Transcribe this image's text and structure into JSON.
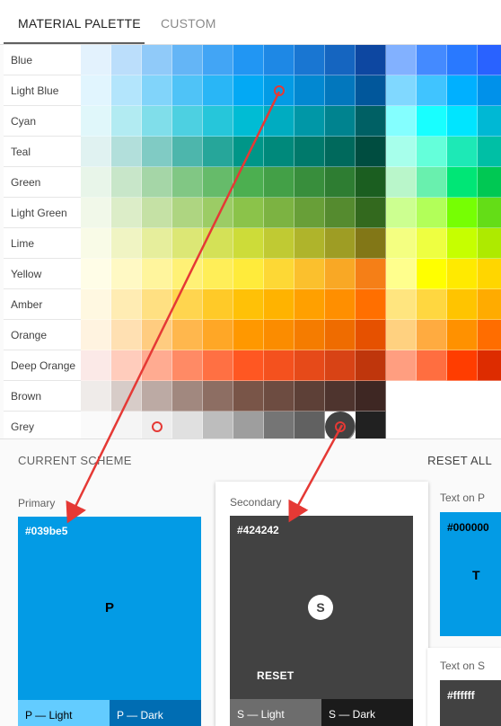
{
  "tabs": {
    "palette": "MATERIAL PALETTE",
    "custom": "CUSTOM"
  },
  "palette": {
    "rows": [
      {
        "name": "Blue",
        "colors": [
          "#e3f2fd",
          "#bbdefb",
          "#90caf9",
          "#64b5f6",
          "#42a5f5",
          "#2196f3",
          "#1e88e5",
          "#1976d2",
          "#1565c0",
          "#0d47a1",
          "#82b1ff",
          "#448aff",
          "#2979ff",
          "#2962ff"
        ]
      },
      {
        "name": "Light Blue",
        "colors": [
          "#e1f5fe",
          "#b3e5fc",
          "#81d4fa",
          "#4fc3f7",
          "#29b6f6",
          "#03a9f4",
          "#039be5",
          "#0288d1",
          "#0277bd",
          "#01579b",
          "#80d8ff",
          "#40c4ff",
          "#00b0ff",
          "#0091ea"
        ]
      },
      {
        "name": "Cyan",
        "colors": [
          "#e0f7fa",
          "#b2ebf2",
          "#80deea",
          "#4dd0e1",
          "#26c6da",
          "#00bcd4",
          "#00acc1",
          "#0097a7",
          "#00838f",
          "#006064",
          "#84ffff",
          "#18ffff",
          "#00e5ff",
          "#00b8d4"
        ]
      },
      {
        "name": "Teal",
        "colors": [
          "#e0f2f1",
          "#b2dfdb",
          "#80cbc4",
          "#4db6ac",
          "#26a69a",
          "#009688",
          "#00897b",
          "#00796b",
          "#00695c",
          "#004d40",
          "#a7ffeb",
          "#64ffda",
          "#1de9b6",
          "#00bfa5"
        ]
      },
      {
        "name": "Green",
        "colors": [
          "#e8f5e9",
          "#c8e6c9",
          "#a5d6a7",
          "#81c784",
          "#66bb6a",
          "#4caf50",
          "#43a047",
          "#388e3c",
          "#2e7d32",
          "#1b5e20",
          "#b9f6ca",
          "#69f0ae",
          "#00e676",
          "#00c853"
        ]
      },
      {
        "name": "Light Green",
        "colors": [
          "#f1f8e9",
          "#dcedc8",
          "#c5e1a5",
          "#aed581",
          "#9ccc65",
          "#8bc34a",
          "#7cb342",
          "#689f38",
          "#558b2f",
          "#33691e",
          "#ccff90",
          "#b2ff59",
          "#76ff03",
          "#64dd17"
        ]
      },
      {
        "name": "Lime",
        "colors": [
          "#f9fbe7",
          "#f0f4c3",
          "#e6ee9c",
          "#dce775",
          "#d4e157",
          "#cddc39",
          "#c0ca33",
          "#afb42b",
          "#9e9d24",
          "#827717",
          "#f4ff81",
          "#eeff41",
          "#c6ff00",
          "#aeea00"
        ]
      },
      {
        "name": "Yellow",
        "colors": [
          "#fffde7",
          "#fff9c4",
          "#fff59d",
          "#fff176",
          "#ffee58",
          "#ffeb3b",
          "#fdd835",
          "#fbc02d",
          "#f9a825",
          "#f57f17",
          "#ffff8d",
          "#ffff00",
          "#ffea00",
          "#ffd600"
        ]
      },
      {
        "name": "Amber",
        "colors": [
          "#fff8e1",
          "#ffecb3",
          "#ffe082",
          "#ffd54f",
          "#ffca28",
          "#ffc107",
          "#ffb300",
          "#ffa000",
          "#ff8f00",
          "#ff6f00",
          "#ffe57f",
          "#ffd740",
          "#ffc400",
          "#ffab00"
        ]
      },
      {
        "name": "Orange",
        "colors": [
          "#fff3e0",
          "#ffe0b2",
          "#ffcc80",
          "#ffb74d",
          "#ffa726",
          "#ff9800",
          "#fb8c00",
          "#f57c00",
          "#ef6c00",
          "#e65100",
          "#ffd180",
          "#ffab40",
          "#ff9100",
          "#ff6d00"
        ]
      },
      {
        "name": "Deep Orange",
        "colors": [
          "#fbe9e7",
          "#ffccbc",
          "#ffab91",
          "#ff8a65",
          "#ff7043",
          "#ff5722",
          "#f4511e",
          "#e64a19",
          "#d84315",
          "#bf360c",
          "#ff9e80",
          "#ff6e40",
          "#ff3d00",
          "#dd2c00"
        ]
      },
      {
        "name": "Brown",
        "colors": [
          "#efebe9",
          "#d7ccc8",
          "#bcaaa4",
          "#a1887f",
          "#8d6e63",
          "#795548",
          "#6d4c41",
          "#5d4037",
          "#4e342e",
          "#3e2723"
        ]
      },
      {
        "name": "Grey",
        "colors": [
          "#fafafa",
          "#f5f5f5",
          "#eeeeee",
          "#e0e0e0",
          "#bdbdbd",
          "#9e9e9e",
          "#757575",
          "#616161",
          "#424242",
          "#212121"
        ]
      }
    ]
  },
  "scheme": {
    "title": "CURRENT SCHEME",
    "reset_all": "RESET ALL",
    "primary": {
      "label": "Primary",
      "hex": "#039be5",
      "letter": "P",
      "light": "P — Light",
      "dark": "P — Dark",
      "color": "#039be5",
      "light_color": "#63ccff",
      "dark_color": "#006db3"
    },
    "secondary": {
      "label": "Secondary",
      "hex": "#424242",
      "letter": "S",
      "reset": "RESET",
      "light": "S — Light",
      "dark": "S — Dark",
      "color": "#424242",
      "light_color": "#6d6d6d",
      "dark_color": "#1b1b1b"
    },
    "text_on_p": {
      "label": "Text on P",
      "hex": "#000000",
      "letter": "T"
    },
    "text_on_s": {
      "label": "Text on S",
      "hex": "#ffffff"
    }
  }
}
